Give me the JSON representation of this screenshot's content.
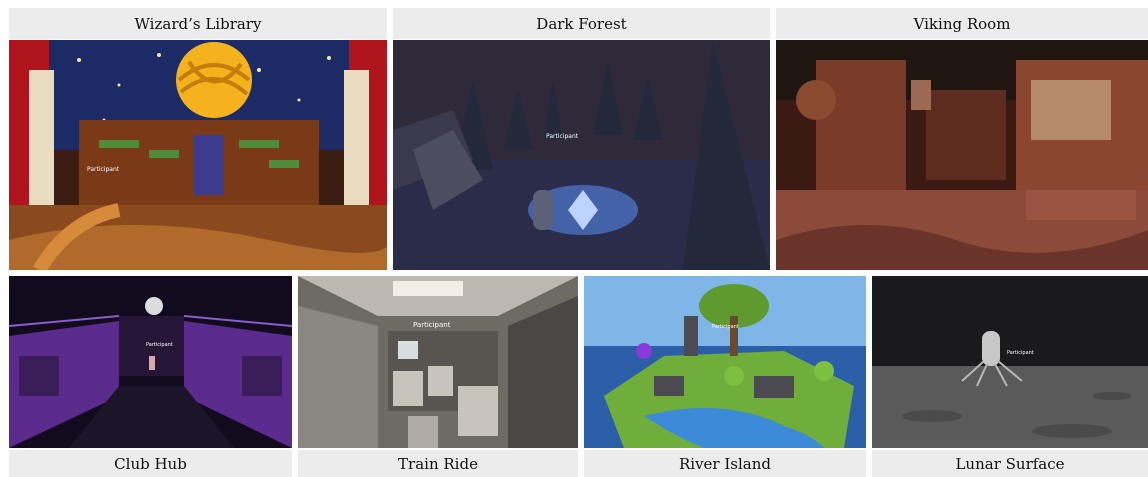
{
  "scenes": [
    {
      "title": "Wizard’s Library",
      "tag": "Participant"
    },
    {
      "title": "Dark Forest",
      "tag": "Participant"
    },
    {
      "title": "Viking Room",
      "tag": ""
    },
    {
      "title": "Club Hub",
      "tag": "Participant"
    },
    {
      "title": "Train Ride",
      "tag": "Participant"
    },
    {
      "title": "River Island",
      "tag": "Participant"
    },
    {
      "title": "Lunar Surface",
      "tag": "Participant"
    }
  ]
}
